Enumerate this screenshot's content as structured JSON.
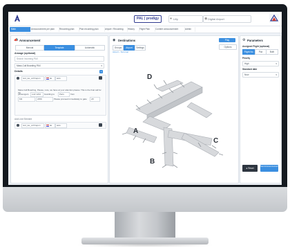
{
  "header": {
    "brand": "PAL | prodigy",
    "user_select": "Lilly",
    "search_select": "Digital Airport"
  },
  "nav_tabs": [
    {
      "label": "Main Announcement",
      "active": true
    },
    {
      "label": "Announcement per plan",
      "active": false
    },
    {
      "label": "Recording plan",
      "active": false
    },
    {
      "label": "Plan recording plan",
      "active": false
    },
    {
      "label": "Airport / Recording",
      "active": false
    },
    {
      "label": "History",
      "active": false
    },
    {
      "label": "Flight Plan",
      "active": false
    },
    {
      "label": "Content announcement",
      "active": false
    },
    {
      "label": "Admin",
      "active": false
    }
  ],
  "left_panel": {
    "title": "Announcement",
    "modes": [
      {
        "label": "Manual",
        "active": false
      },
      {
        "label": "Template",
        "active": true
      },
      {
        "label": "Automatic",
        "active": false
      }
    ],
    "search_label": "Ansage (optional)",
    "search_placeholder": "Search Incoming PAX",
    "select_value": "Mass-Call Boarding PAX",
    "details_label": "Details",
    "lang_select": "text_we_orchrepon",
    "lang_code": "de",
    "voice": "auto",
    "text_line1": "Mass-Call Boarding, Please, note, we have at your attention please. This is the final call for the",
    "text_line2_a": "passengers",
    "text_line2_b": "LH2 1234",
    "text_line2_c": "boarding to",
    "text_line2_d": "Paris",
    "text_line2_e": "from",
    "field_1": "M3",
    "field_2": "2359",
    "text_line3": "Please proceed immediately to gate",
    "field_3": "A5",
    "add_label": "Add Line Element",
    "add_row_select": "text_we_orchrepon",
    "add_row_lang": "de",
    "add_row_voice": "auto"
  },
  "center_panel": {
    "title": "Destinations",
    "preview_button": "Play",
    "select_button": "Options",
    "tabs": [
      {
        "label": "Groups",
        "active": false
      },
      {
        "label": "Airport",
        "active": true
      },
      {
        "label": "Settings",
        "active": false
      }
    ],
    "breadcrumb": "Airport › Terminal",
    "zones": [
      "A",
      "B",
      "C",
      "D"
    ]
  },
  "right_panel": {
    "title": "Parameters",
    "assigned_label": "Assigned Flight (optional)",
    "assigned_tabs": [
      {
        "label": "Flight No.",
        "active": true
      },
      {
        "label": "Pax",
        "active": false
      },
      {
        "label": "Both",
        "active": false
      }
    ],
    "priority_label": "Priority",
    "priority_value": "High",
    "standard_label": "Standard date",
    "standard_value": "Now",
    "reset_button": "Reset",
    "send_button": "Send Announcement"
  },
  "colors": {
    "accent": "#3b8fe0",
    "dark": "#3a4450"
  }
}
